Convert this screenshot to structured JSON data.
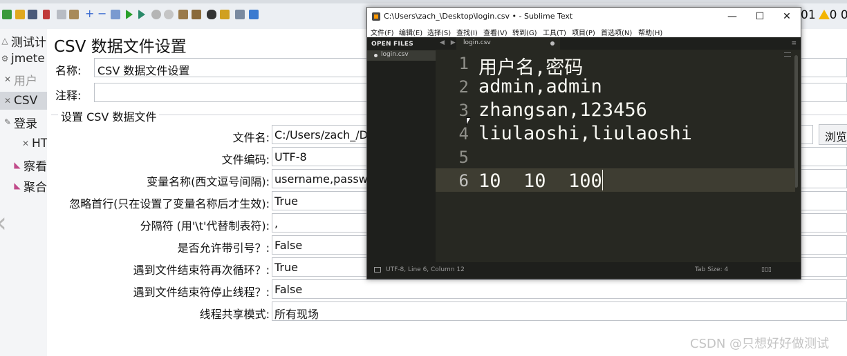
{
  "jmeter": {
    "status_right": "01",
    "status_warning": "0 0,",
    "tree": {
      "items": [
        {
          "label": "测试计"
        },
        {
          "label": "jmete"
        },
        {
          "label": "用户"
        },
        {
          "label": "CSV"
        },
        {
          "label": "登录"
        },
        {
          "label": "HT"
        },
        {
          "label": "察看"
        },
        {
          "label": "聚合"
        }
      ]
    },
    "form": {
      "title": "CSV 数据文件设置",
      "name_label": "名称:",
      "name_value": "CSV 数据文件设置",
      "comment_label": "注释:",
      "comment_value": "",
      "section_title": "设置 CSV 数据文件",
      "browse_label": "浏览",
      "rows": [
        {
          "label": "文件名:",
          "value": "C:/Users/zach_/De"
        },
        {
          "label": "文件编码:",
          "value": "UTF-8"
        },
        {
          "label": "变量名称(西文逗号间隔):",
          "value": "username,passwo"
        },
        {
          "label": "忽略首行(只在设置了变量名称后才生效):",
          "value": "True"
        },
        {
          "label": "分隔符 (用'\\t'代替制表符):",
          "value": ","
        },
        {
          "label": "是否允许带引号？:",
          "value": "False"
        },
        {
          "label": "遇到文件结束符再次循环？:",
          "value": "True"
        },
        {
          "label": "遇到文件结束符停止线程？:",
          "value": "False"
        },
        {
          "label": "线程共享模式:",
          "value": "所有现场"
        }
      ]
    }
  },
  "sublime": {
    "title": "C:\\Users\\zach_\\Desktop\\login.csv • - Sublime Text",
    "window_buttons": {
      "minimize": "—",
      "maximize": "☐",
      "close": "✕"
    },
    "menu": [
      "文件(F)",
      "编辑(E)",
      "选择(S)",
      "查找(I)",
      "查看(V)",
      "转到(G)",
      "工具(T)",
      "项目(P)",
      "首选项(N)",
      "帮助(H)"
    ],
    "sidebar": {
      "header": "OPEN FILES",
      "files": [
        "login.csv"
      ]
    },
    "tab": {
      "name": "login.csv",
      "arrows": "◀ ▶",
      "menu_icon": "≡"
    },
    "lines": [
      {
        "num": "1",
        "text": "用户名,密码"
      },
      {
        "num": "2",
        "text": "admin,admin"
      },
      {
        "num": "3",
        "text": "zhangsan,123456"
      },
      {
        "num": "4",
        "text": "liulaoshi,liulaoshi"
      },
      {
        "num": "5",
        "text": ""
      },
      {
        "num": "6",
        "text": "10  10  100"
      }
    ],
    "current_line": 6,
    "status": {
      "position": "UTF-8, Line 6, Column 12",
      "tab_size": "Tab Size: 4",
      "syntax_icon": "▯▯▯"
    }
  },
  "watermark": "CSDN @只想好好做测试"
}
